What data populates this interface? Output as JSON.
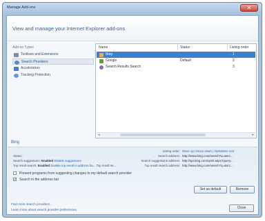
{
  "window": {
    "title": "Manage Add-ons",
    "close_glyph": "✕"
  },
  "header": {
    "text": "View and manage your Internet Explorer add-ons"
  },
  "sidebar": {
    "title": "Add-on Types",
    "items": [
      {
        "label": "Toolbars and Extensions",
        "icon": "gear-icon",
        "color": "#7a8fa6"
      },
      {
        "label": "Search Providers",
        "icon": "search-icon",
        "color": "#5a8ac2"
      },
      {
        "label": "Accelerators",
        "icon": "accelerator-icon",
        "color": "#4d78c4"
      },
      {
        "label": "Tracking Protection",
        "icon": "tracking-protection-icon",
        "color": "#5b9bd8"
      }
    ]
  },
  "list": {
    "columns": [
      "Name",
      "Status",
      "Listing order"
    ],
    "rows": [
      {
        "name": "Bing",
        "status": "",
        "order": "1",
        "icon": "bing-icon",
        "color": "#f2a93b"
      },
      {
        "name": "Google",
        "status": "Default",
        "order": "2",
        "icon": "google-icon",
        "color": "#5f9e3a"
      },
      {
        "name": "Search Results Search",
        "status": "",
        "order": "3",
        "icon": "search-icon",
        "color": "#8a6bb2"
      }
    ]
  },
  "details": {
    "title": "Bing",
    "status_label": "Status:",
    "search_suggestions": "Search suggestions:",
    "search_suggestions_state": "Enabled",
    "search_suggestions_link": "Disable suggestions",
    "top_result": "Top result search:",
    "top_result_state": "Enabled",
    "top_result_link": "Disable top result in address ba...",
    "top_result_extra": "Top result se...",
    "kv": [
      {
        "label": "Listing order:",
        "value": "Move up | Move down | Alphabetic sort"
      },
      {
        "label": "Search address:",
        "value": "http://www.bing.com/search?q=&src..."
      },
      {
        "label": "Search suggestions address:",
        "value": "http://api.bing.com/qsml.aspx?query..."
      },
      {
        "label": "Top result search address:",
        "value": "http://www.bing.com/search?q=&src..."
      }
    ]
  },
  "checkboxes": [
    {
      "label": "Prevent programs from suggesting changes to my default search provider",
      "checked": false
    },
    {
      "label": "Search in the address bar",
      "checked": true
    }
  ],
  "buttons": {
    "set_default": "Set as default",
    "remove": "Remove",
    "close": "Close"
  },
  "footer": {
    "find_more": "Find more search providers...",
    "learn_more": "Learn more about search provider preferences"
  },
  "colors": {
    "accent": "#3d80d0",
    "link": "#2a64b3",
    "header_text": "#3d6391"
  }
}
